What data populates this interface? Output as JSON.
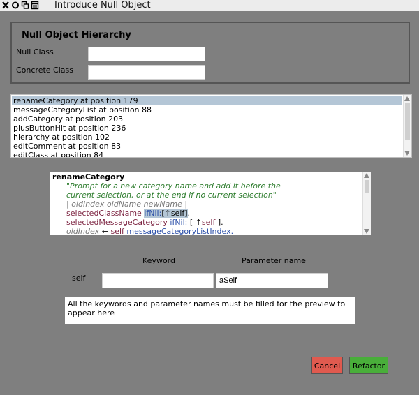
{
  "window": {
    "title": "Introduce Null Object",
    "icons": [
      "close-icon",
      "menu-icon",
      "collapse-icon",
      "expand-icon"
    ]
  },
  "hierarchy": {
    "title": "Null Object Hierarchy",
    "null_class_label": "Null Class",
    "null_class_value": "",
    "concrete_class_label": "Concrete Class",
    "concrete_class_value": ""
  },
  "references": [
    "renameCategory at position 179",
    "messageCategoryList at position 88",
    "addCategory at position 203",
    "plusButtonHit at position 236",
    "hierarchy at position 102",
    "editComment at position 83",
    "editClass at position 84"
  ],
  "selected_reference": 0,
  "code": {
    "method_name": "renameCategory",
    "comment_line1": "\"Prompt for a new category name and add it before the",
    "comment_line2": "current selection, or at the end if no current selection\"",
    "temps": "| oldIndex oldName newName |",
    "line4_msg": "selectedClassName",
    "line4_kw": "ifNil:",
    "line4_block": "[↑self]",
    "line4_end": ".",
    "line5_msg": "selectedMessageCategory",
    "line5_kw": "ifNil:",
    "line5_block_open": "[ ↑",
    "line5_self": "self",
    "line5_block_close": " ].",
    "line6_var": "oldIndex",
    "line6_assign": " ← ",
    "line6_self": "self",
    "line6_msg": " messageCategoryListIndex."
  },
  "params": {
    "keyword_header": "Keyword",
    "parameter_header": "Parameter name",
    "row_label": "self",
    "keyword_value": "",
    "parameter_value": "aSelf"
  },
  "preview_text": "All the keywords and parameter names must be filled for the preview to appear here",
  "buttons": {
    "cancel": "Cancel",
    "refactor": "Refactor"
  },
  "colors": {
    "background": "#7f7f7f",
    "selection": "#b4c6d6",
    "cancel": "#e05a4f",
    "refactor": "#49ae3a"
  }
}
